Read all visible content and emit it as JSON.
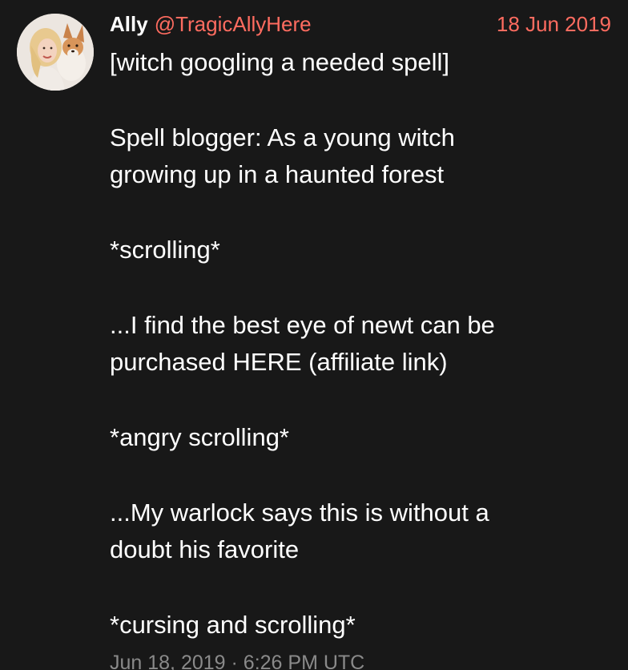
{
  "tweet": {
    "fullname": "Ally",
    "username": "@TragicAllyHere",
    "date": "18 Jun 2019",
    "avatar_alt": "avatar",
    "content": {
      "p1": {
        "l1": "[witch googling a needed spell]"
      },
      "p2": {
        "l1": "Spell blogger: As a young witch",
        "l2": "growing up in a haunted forest"
      },
      "p3": {
        "l1": "*scrolling*"
      },
      "p4": {
        "l1": "...I find the best eye of newt can be",
        "l2": "purchased HERE (affiliate link)"
      },
      "p5": {
        "l1": "*angry scrolling*"
      },
      "p6": {
        "l1": "...My warlock says this is without a",
        "l2": "doubt his favorite"
      },
      "p7": {
        "l1": "*cursing and scrolling*"
      }
    },
    "published": "Jun 18, 2019 · 6:26 PM UTC"
  },
  "colors": {
    "background": "#181818",
    "text": "#ffffff",
    "accent": "#ff6c60",
    "muted": "#8a8a8a"
  }
}
